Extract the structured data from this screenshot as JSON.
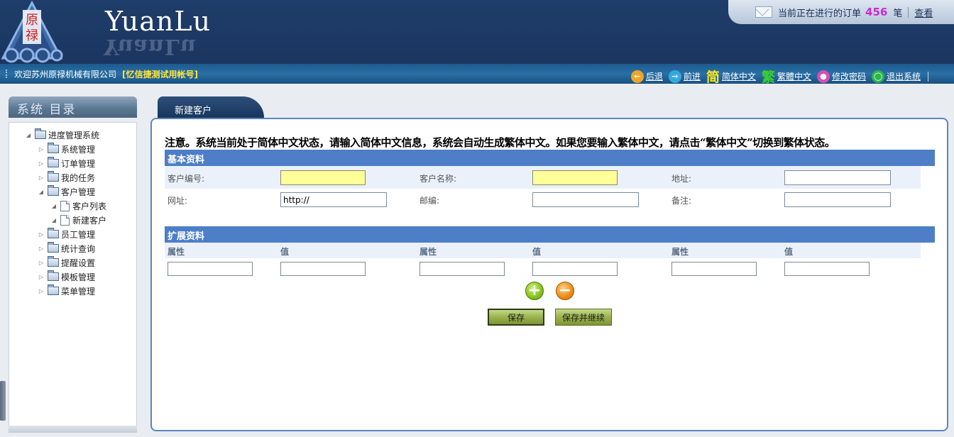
{
  "header": {
    "logo_text_top": "原",
    "logo_text_bottom": "禄",
    "brand": "YuanLu",
    "order_prefix": "当前正在进行的订单",
    "order_count": "456",
    "order_suffix": "笔",
    "order_view": "查看"
  },
  "welcome": {
    "text": "欢迎苏州原禄机械有限公司",
    "account": "[忆信捷测试用帐号]",
    "links": [
      {
        "glyph": "←",
        "label": "后退",
        "color": "#f0a428"
      },
      {
        "glyph": "→",
        "label": "前进",
        "color": "#35a8e0"
      },
      {
        "glyph": "简",
        "label": "简体中文",
        "color": "#ffe81a"
      },
      {
        "glyph": "繁",
        "label": "繁體中文",
        "color": "#3bd12a"
      },
      {
        "glyph": "🔒",
        "label": "修改密码",
        "color": "#d64fb7"
      },
      {
        "glyph": "⏻",
        "label": "退出系统",
        "color": "#2db54a"
      }
    ]
  },
  "sidebar": {
    "title": "系统 目录",
    "root": "进度管理系统",
    "items": [
      {
        "label": "系统管理"
      },
      {
        "label": "订单管理"
      },
      {
        "label": "我的任务"
      },
      {
        "label": "客户管理"
      },
      {
        "label": "客户列表"
      },
      {
        "label": "新建客户"
      },
      {
        "label": "员工管理"
      },
      {
        "label": "统计查询"
      },
      {
        "label": "提醒设置"
      },
      {
        "label": "模板管理"
      },
      {
        "label": "菜单管理"
      }
    ]
  },
  "main": {
    "tab": "新建客户",
    "notice": "注意。系统当前处于简体中文状态，请输入简体中文信息，系统会自动生成繁体中文。如果您要输入繁体中文，请点击“繁体中文”切换到繁体状态。",
    "basic_title": "基本资料",
    "fields": {
      "customer_no": "客户编号:",
      "customer_name": "客户名称:",
      "address": "地址:",
      "website": "网址:",
      "website_value": "http://",
      "zipcode": "邮编:",
      "remark": "备注:"
    },
    "ext_title": "扩展资料",
    "ext_cols": [
      "属性",
      "值",
      "属性",
      "值",
      "属性",
      "值"
    ],
    "save_label": "保存",
    "save_continue_label": "保存并继续"
  }
}
